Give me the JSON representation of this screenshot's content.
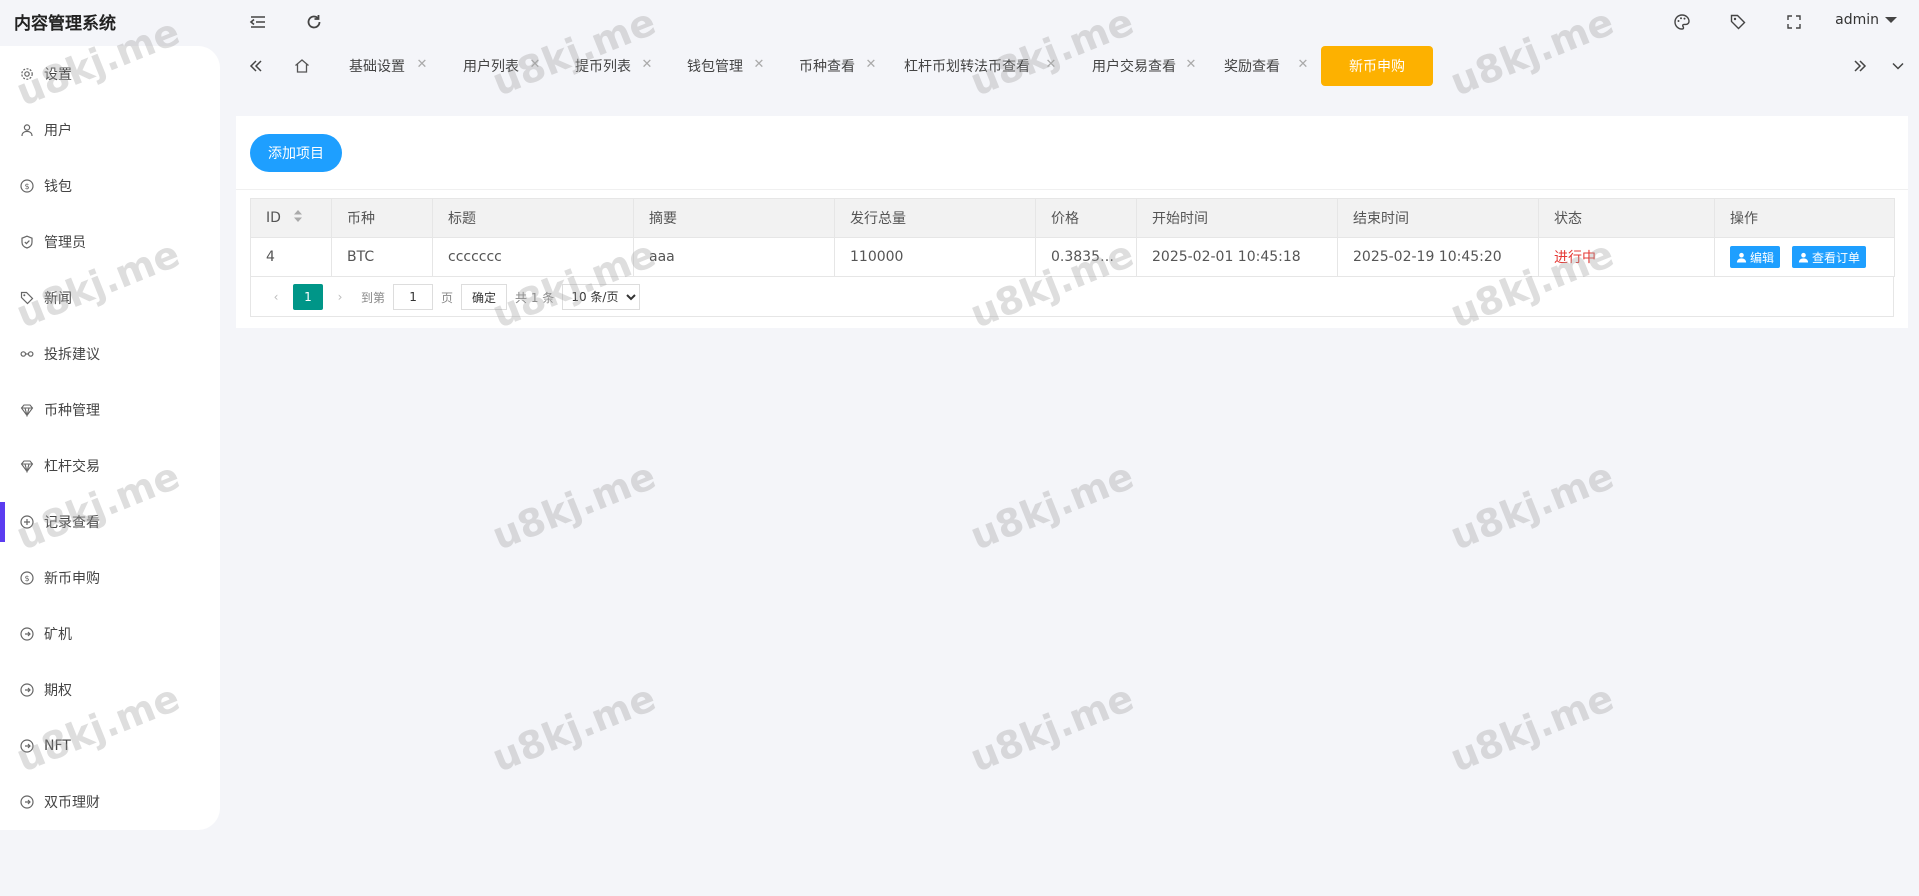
{
  "app": {
    "title": "内容管理系统",
    "user": "admin"
  },
  "colors": {
    "accent": "#1e9fff",
    "active_tab": "#fdb100",
    "pager_current": "#009688",
    "status_running": "#e53935",
    "sidebar_indicator": "#5b3cf0"
  },
  "topbar": {
    "icons": [
      "menu-fold-icon",
      "refresh-icon",
      "palette-icon",
      "tag-icon",
      "fullscreen-icon"
    ]
  },
  "sidebar": {
    "items": [
      {
        "label": "设置",
        "icon": "gear-icon"
      },
      {
        "label": "用户",
        "icon": "user-icon"
      },
      {
        "label": "钱包",
        "icon": "dollar-icon"
      },
      {
        "label": "管理员",
        "icon": "shield-icon"
      },
      {
        "label": "新闻",
        "icon": "tag-icon"
      },
      {
        "label": "投拆建议",
        "icon": "link-icon"
      },
      {
        "label": "币种管理",
        "icon": "diamond-icon"
      },
      {
        "label": "杠杆交易",
        "icon": "diamond-icon"
      },
      {
        "label": "记录查看",
        "icon": "circle-plus-icon",
        "active": true
      },
      {
        "label": "新币申购",
        "icon": "dollar-icon"
      },
      {
        "label": "矿机",
        "icon": "circle-arrow-icon"
      },
      {
        "label": "期权",
        "icon": "circle-arrow-icon"
      },
      {
        "label": "NFT",
        "icon": "circle-arrow-icon"
      },
      {
        "label": "双币理财",
        "icon": "circle-arrow-icon"
      }
    ]
  },
  "tabs": {
    "items": [
      {
        "label": "基础设置"
      },
      {
        "label": "用户列表"
      },
      {
        "label": "提币列表"
      },
      {
        "label": "钱包管理"
      },
      {
        "label": "币种查看"
      },
      {
        "label": "杠杆币划转法币查看"
      },
      {
        "label": "用户交易查看"
      },
      {
        "label": "奖励查看"
      },
      {
        "label": "新币申购",
        "active": true
      }
    ]
  },
  "toolbar": {
    "add_label": "添加项目"
  },
  "table": {
    "headers": [
      "ID",
      "币种",
      "标题",
      "摘要",
      "发行总量",
      "价格",
      "开始时间",
      "结束时间",
      "状态",
      "操作"
    ],
    "rows": [
      {
        "id": "4",
        "coin": "BTC",
        "title": "ccccccc",
        "summary": "aaa",
        "total": "110000",
        "price": "0.38352...",
        "start": "2025-02-01 10:45:18",
        "end": "2025-02-19 10:45:20",
        "status": "进行中",
        "edit_label": "编辑",
        "orders_label": "查看订单"
      }
    ]
  },
  "pager": {
    "current": "1",
    "goto_label": "到第",
    "goto_value": "1",
    "page_label": "页",
    "confirm_label": "确定",
    "total_label": "共 1 条",
    "size_option": "10 条/页"
  },
  "watermark": "u8kj.me"
}
